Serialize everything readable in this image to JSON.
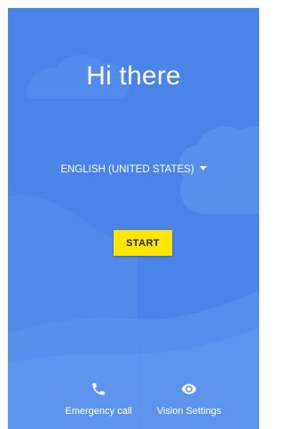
{
  "welcome": {
    "title": "Hi there",
    "language_selector": "ENGLISH (UNITED STATES)",
    "start_button": "START"
  },
  "bottom_actions": [
    {
      "label": "Emergency call",
      "icon": "phone-icon"
    },
    {
      "label": "Vision Settings",
      "icon": "eye-icon"
    }
  ],
  "colors": {
    "background": "#4a84e8",
    "cloud_light": "#5a92ee",
    "cloud_lighter": "#6aa0f1",
    "start_button": "#ffe600",
    "text": "#ffffff"
  }
}
